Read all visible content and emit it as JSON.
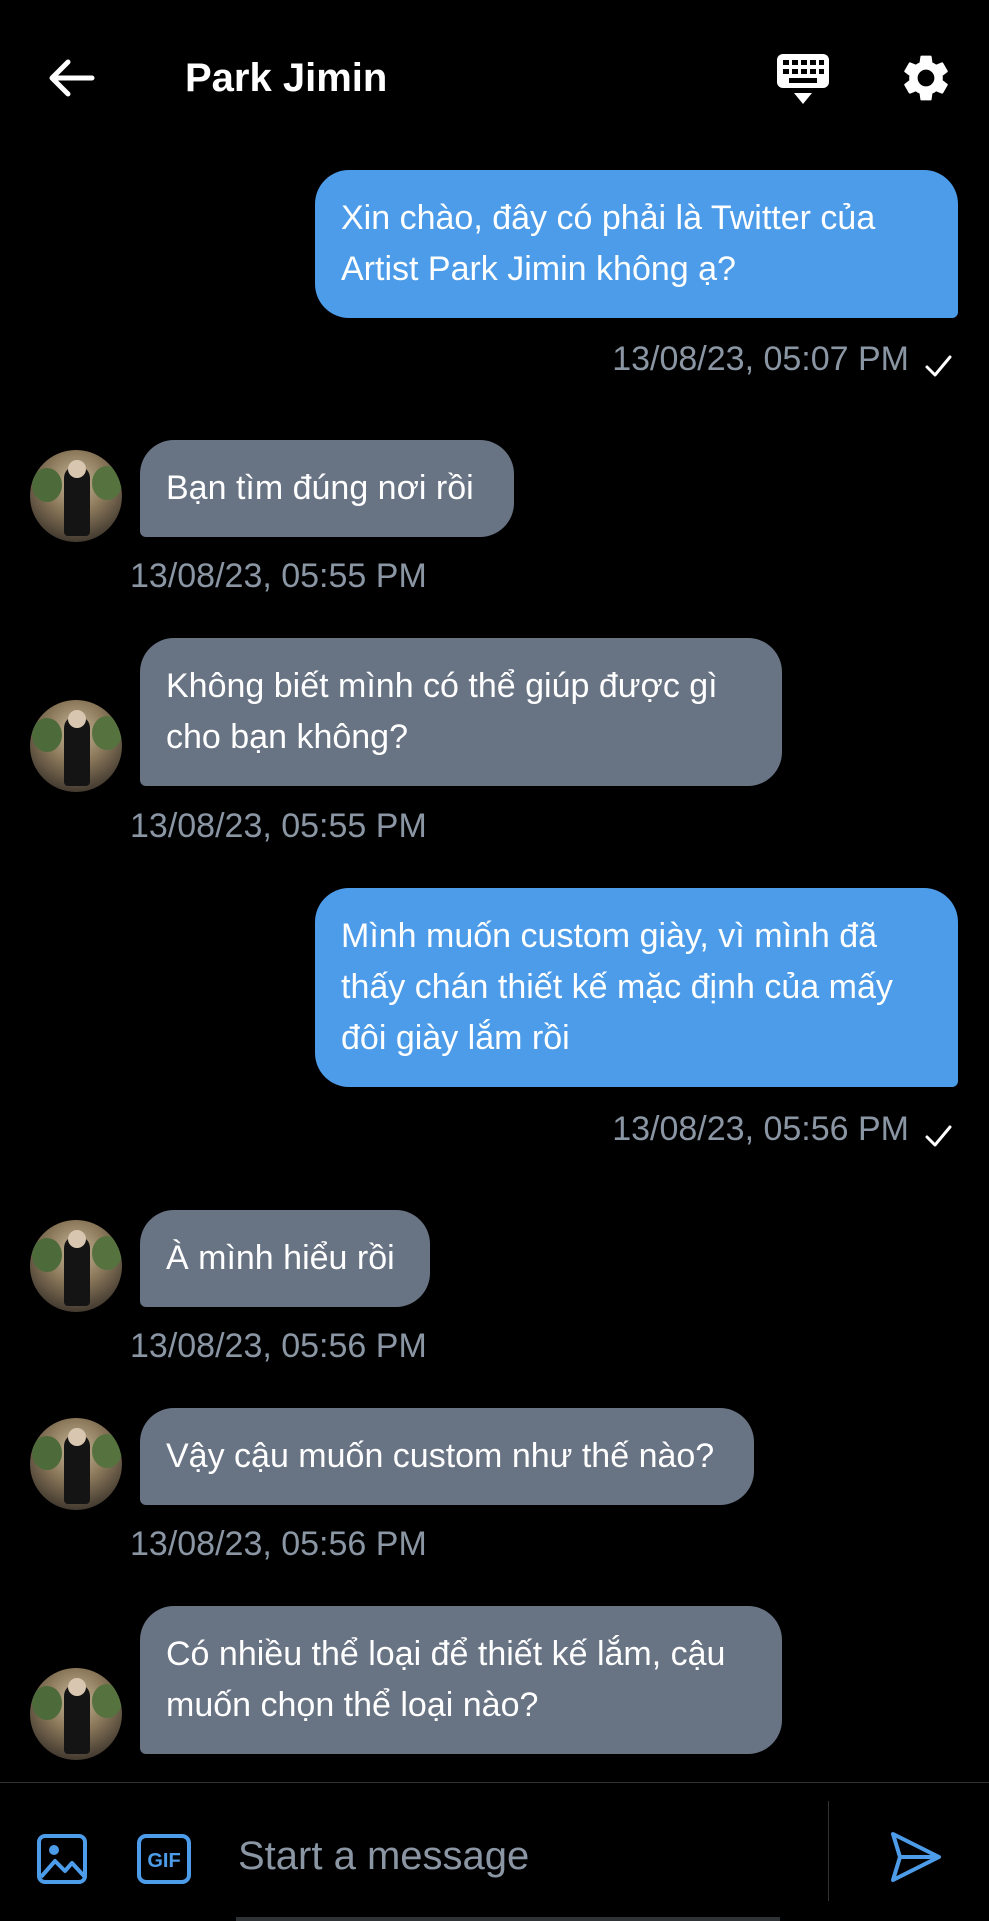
{
  "header": {
    "title": "Park Jimin",
    "icons": [
      "back-arrow-icon",
      "keyboard-icon",
      "gear-icon"
    ]
  },
  "messages": [
    {
      "direction": "out",
      "text": "Xin chào, đây có phải là Twitter của Artist Park Jimin không ạ?",
      "timestamp": "13/08/23, 05:07 PM",
      "read": true
    },
    {
      "direction": "in",
      "text": "Bạn tìm đúng nơi rồi",
      "timestamp": "13/08/23, 05:55 PM"
    },
    {
      "direction": "in",
      "text": "Không biết mình có thể giúp được gì cho bạn không?",
      "timestamp": "13/08/23, 05:55 PM"
    },
    {
      "direction": "out",
      "text": "Mình muốn custom giày, vì mình đã thấy chán thiết kế mặc định của mấy đôi giày lắm rồi",
      "timestamp": "13/08/23, 05:56 PM",
      "read": true
    },
    {
      "direction": "in",
      "text": "À mình hiểu rồi",
      "timestamp": "13/08/23, 05:56 PM"
    },
    {
      "direction": "in",
      "text": "Vậy cậu muốn custom như thế nào?",
      "timestamp": "13/08/23, 05:56 PM"
    },
    {
      "direction": "in",
      "text": "Có nhiều thể loại để thiết kế lắm, cậu muốn chọn thể loại nào?",
      "timestamp": ""
    }
  ],
  "composer": {
    "placeholder": "Start a message",
    "gif_label": "GIF",
    "icons": [
      "image-icon",
      "gif-icon",
      "send-icon"
    ]
  },
  "colors": {
    "background": "#000000",
    "outgoing_bubble": "#4c9ce9",
    "incoming_bubble": "#687384",
    "timestamp": "#8b96a4"
  }
}
